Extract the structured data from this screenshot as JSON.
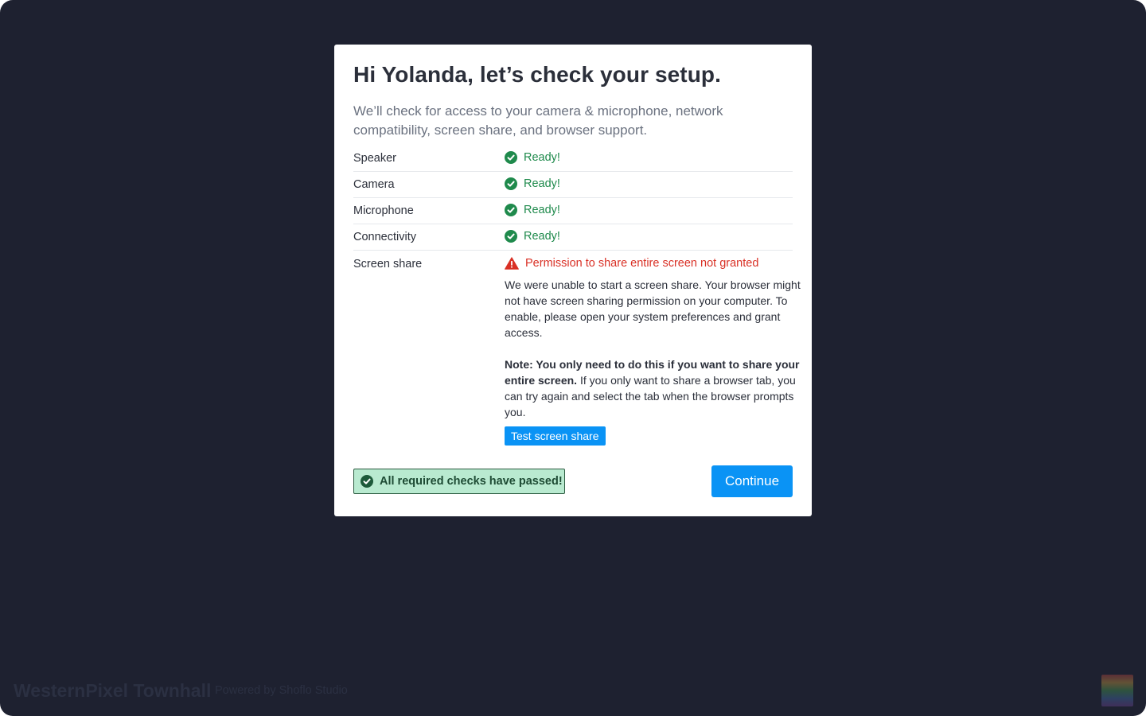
{
  "dialog": {
    "title": "Hi Yolanda, let’s check your setup.",
    "intro": "We’ll check for access to your camera & microphone, network compatibility, screen share, and browser support."
  },
  "checks": [
    {
      "label": "Speaker",
      "status": "Ready!",
      "icon": "check-circle-icon"
    },
    {
      "label": "Camera",
      "status": "Ready!",
      "icon": "check-circle-icon"
    },
    {
      "label": "Microphone",
      "status": "Ready!",
      "icon": "check-circle-icon"
    },
    {
      "label": "Connectivity",
      "status": "Ready!",
      "icon": "check-circle-icon"
    }
  ],
  "screen_share": {
    "label": "Screen share",
    "status": "Permission to share entire screen not granted",
    "icon": "warning-triangle-icon",
    "description": "We were unable to start a screen share.  Your browser might not have screen sharing permission on your computer.  To enable, please open your system preferences and grant access.",
    "note_bold": "Note:  You only need to do this if you want to share your entire screen.",
    "note_rest": "  If you only want to share a browser tab, you can try again and select the tab when the browser prompts you.",
    "button_label": "Test screen share"
  },
  "summary": {
    "passed_text": "All required checks have passed!",
    "icon": "check-circle-icon"
  },
  "continue_label": "Continue",
  "footer": {
    "brand": "WesternPixel Townhall",
    "powered": "Powered by Shoflo Studio"
  },
  "colors": {
    "background": "#1e2130",
    "accent": "#0a93f5",
    "success": "#1f8a4c",
    "error": "#d93025",
    "success_banner": "#b9ead0"
  }
}
